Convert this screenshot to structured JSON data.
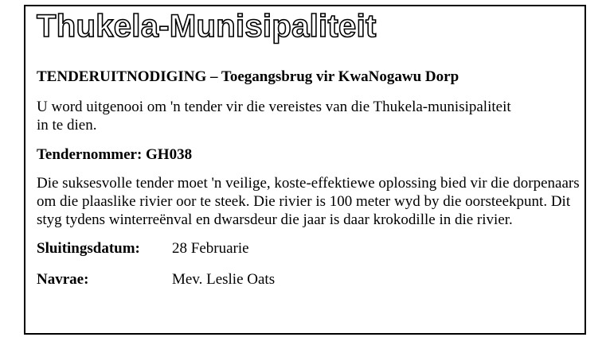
{
  "logo": {
    "text": "Thukela-Munisipaliteit"
  },
  "notice": {
    "heading": "TENDERUITNODIGING – Toegangsbrug vir KwaNogawu Dorp",
    "intro": "U word uitgenooi om 'n tender vir die vereistes van die Thukela-munisipaliteit in te dien.",
    "tender_number": "Tendernommer: GH038",
    "description": "Die suksesvolle tender moet 'n veilige, koste-effektiewe oplossing bied vir die dorpenaars om die plaaslike rivier oor te steek. Die rivier is 100 meter wyd by die oorsteekpunt. Dit styg tydens winterreënval en dwarsdeur die jaar is daar krokodille in die rivier.",
    "closing_date": {
      "label": "Sluitingsdatum:",
      "value": "28 Februarie"
    },
    "enquiries": {
      "label": "Navrae:",
      "value": "Mev. Leslie Oats"
    }
  }
}
